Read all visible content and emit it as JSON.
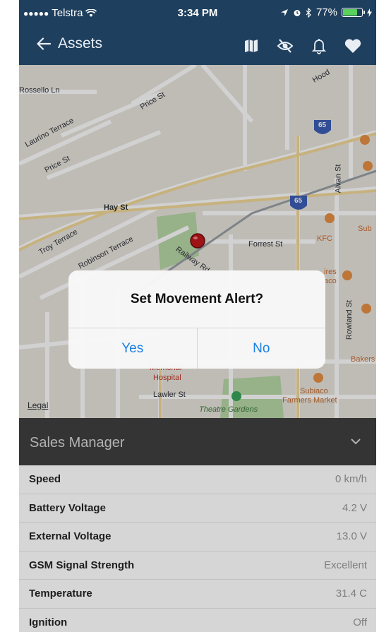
{
  "status_bar": {
    "carrier": "Telstra",
    "time": "3:34 PM",
    "battery": "77%",
    "battery_level": 0.77
  },
  "nav": {
    "back_label": "Assets",
    "icons": [
      "map-icon",
      "eye-off-icon",
      "bell-icon",
      "heart-icon"
    ]
  },
  "map": {
    "labels": {
      "rossello": "Rossello Ln",
      "price_st": "Price St",
      "laurino": "Laurino Terrace",
      "price_st_2": "Price St",
      "hay_st": "Hay St",
      "troy": "Troy Terrace",
      "robinson": "Robinson Terrace",
      "railway": "Railway Rd",
      "forrest": "Forrest St",
      "hood": "Hood",
      "alvan": "Alvan St",
      "rowland": "Rowland St",
      "kfc": "KFC",
      "sub": "Sub",
      "hospital_1": "Memorial",
      "hospital_2": "Hospital",
      "lawler": "Lawler St",
      "theatre": "Theatre Gardens",
      "subiaco_1": "Subiaco",
      "subiaco_2": "Farmers Market",
      "bakers": "Bakers",
      "ires": "ires",
      "aco": "aco",
      "rt65_a": "65",
      "rt65_b": "65",
      "legal": "Legal"
    }
  },
  "alert": {
    "title": "Set Movement Alert?",
    "yes": "Yes",
    "no": "No"
  },
  "panel": {
    "title": "Sales Manager",
    "rows": [
      {
        "key": "Speed",
        "value": "0 km/h"
      },
      {
        "key": "Battery Voltage",
        "value": "4.2 V"
      },
      {
        "key": "External Voltage",
        "value": "13.0 V"
      },
      {
        "key": "GSM Signal Strength",
        "value": "Excellent"
      },
      {
        "key": "Temperature",
        "value": "31.4 C"
      },
      {
        "key": "Ignition",
        "value": "Off"
      }
    ]
  },
  "colors": {
    "nav_bg": "#1f3f5e",
    "accent": "#1a7fe6",
    "panel_header": "#3a3a3a"
  }
}
